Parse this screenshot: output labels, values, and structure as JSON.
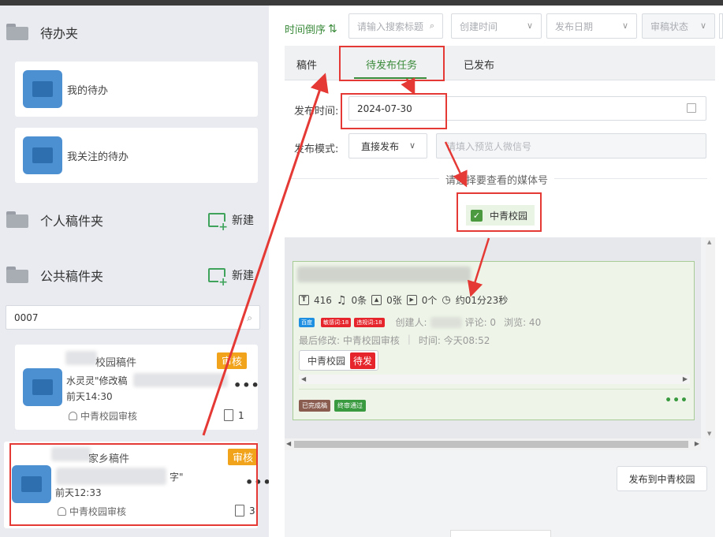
{
  "sidebar": {
    "todo_folder": {
      "label": "待办夹"
    },
    "todo_items": [
      {
        "label": "我的待办"
      },
      {
        "label": "我关注的待办"
      }
    ],
    "personal_folder": {
      "label": "个人稿件夹",
      "new_label": "新建"
    },
    "public_folder": {
      "label": "公共稿件夹",
      "new_label": "新建"
    },
    "search": {
      "value": "0007"
    },
    "docs": [
      {
        "title": "校园稿件",
        "badge": "审核",
        "desc": "水灵灵\"修改稿",
        "time": "前天14:30",
        "user": "中青校园审核",
        "count": "1"
      },
      {
        "title": "家乡稿件",
        "badge": "审核",
        "desc": "字\"",
        "time": "前天12:33",
        "user": "中青校园审核",
        "count": "3"
      }
    ]
  },
  "toolbar": {
    "sort_label": "时间倒序",
    "search_placeholder": "请输入搜索标题",
    "create_time": "创建时间",
    "publish_date": "发布日期",
    "review_status": "审稿状态"
  },
  "tabs": [
    {
      "label": "稿件"
    },
    {
      "label": "待发布任务"
    },
    {
      "label": "已发布"
    }
  ],
  "form": {
    "publish_time_label": "发布时间:",
    "publish_time_value": "2024-07-30",
    "publish_mode_label": "发布模式:",
    "publish_mode_value": "直接发布",
    "preview_placeholder": "请填入预览人微信号",
    "media_hint": "请选择要查看的媒体号",
    "media_checkbox": "中青校园"
  },
  "article": {
    "words": "416",
    "audio": "0条",
    "images": "0张",
    "video": "0个",
    "duration": "约01分23秒",
    "tags": [
      "百度",
      "敏感词:18",
      "违规词:18"
    ],
    "creator_label": "创建人:",
    "comments": "评论: 0",
    "views": "浏览: 40",
    "last_edit": "最后修改: 中青校园审核",
    "edit_time": "时间: 今天08:52",
    "media_name": "中青校园",
    "media_status": "待发",
    "status_done": "已完成稿",
    "status_pass": "终审通过"
  },
  "publish_button": "发布到中青校园",
  "colors": {
    "accent_green": "#3a8a3a",
    "badge_orange": "#f2a31c",
    "annotation_red": "#e53935"
  }
}
